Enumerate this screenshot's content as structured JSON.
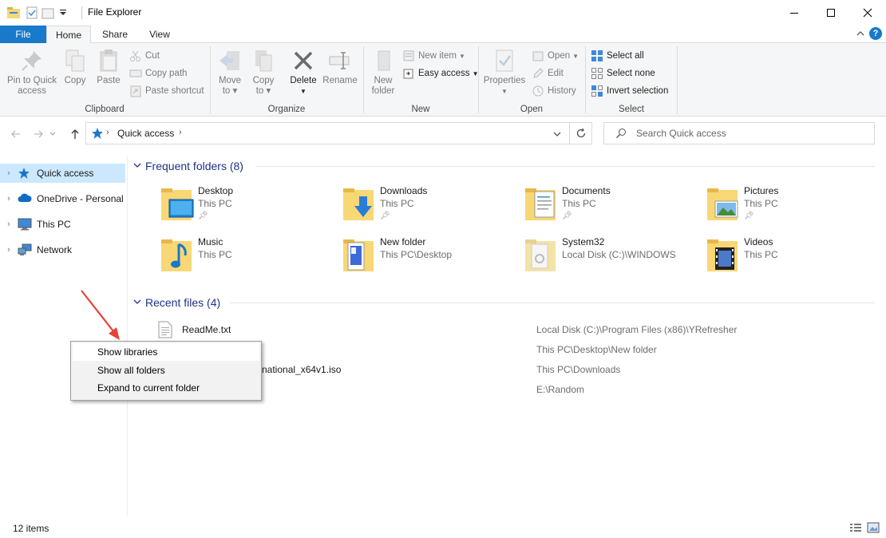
{
  "window": {
    "title": "File Explorer"
  },
  "ribbon_tabs": {
    "file": "File",
    "home": "Home",
    "share": "Share",
    "view": "View"
  },
  "ribbon": {
    "clipboard": {
      "label": "Clipboard",
      "pin_line1": "Pin to Quick",
      "pin_line2": "access",
      "copy": "Copy",
      "paste": "Paste",
      "cut": "Cut",
      "copy_path": "Copy path",
      "paste_shortcut": "Paste shortcut"
    },
    "organize": {
      "label": "Organize",
      "move_line1": "Move",
      "move_line2": "to",
      "copyto_line1": "Copy",
      "copyto_line2": "to",
      "delete": "Delete",
      "rename": "Rename"
    },
    "new": {
      "label": "New",
      "newfolder_line1": "New",
      "newfolder_line2": "folder",
      "new_item": "New item",
      "easy_access": "Easy access"
    },
    "open": {
      "label": "Open",
      "properties": "Properties",
      "open": "Open",
      "edit": "Edit",
      "history": "History"
    },
    "select": {
      "label": "Select",
      "select_all": "Select all",
      "select_none": "Select none",
      "invert_selection": "Invert selection"
    }
  },
  "address": {
    "location": "Quick access",
    "search_placeholder": "Search Quick access"
  },
  "nav": {
    "items": [
      {
        "label": "Quick access"
      },
      {
        "label": "OneDrive - Personal"
      },
      {
        "label": "This PC"
      },
      {
        "label": "Network"
      }
    ]
  },
  "frequent": {
    "header": "Frequent folders (8)",
    "folders": [
      {
        "name": "Desktop",
        "location": "This PC",
        "icon": "desktop-folder-icon"
      },
      {
        "name": "Downloads",
        "location": "This PC",
        "icon": "downloads-folder-icon"
      },
      {
        "name": "Documents",
        "location": "This PC",
        "icon": "documents-folder-icon"
      },
      {
        "name": "Pictures",
        "location": "This PC",
        "icon": "pictures-folder-icon"
      },
      {
        "name": "Music",
        "location": "This PC",
        "icon": "music-folder-icon"
      },
      {
        "name": "New folder",
        "location": "This PC\\Desktop",
        "icon": "new-folder-icon"
      },
      {
        "name": "System32",
        "location": "Local Disk (C:)\\WINDOWS",
        "icon": "system32-folder-icon"
      },
      {
        "name": "Videos",
        "location": "This PC",
        "icon": "videos-folder-icon"
      }
    ]
  },
  "recent": {
    "header": "Recent files (4)",
    "files": [
      {
        "name": "ReadMe.txt",
        "path": "Local Disk (C:)\\Program Files (x86)\\YRefresher"
      },
      {
        "name": "",
        "path": "This PC\\Desktop\\New folder"
      },
      {
        "name": "national_x64v1.iso",
        "path": "This PC\\Downloads"
      },
      {
        "name": "",
        "path": "E:\\Random"
      }
    ]
  },
  "context_menu": {
    "items": [
      {
        "label": "Show libraries"
      },
      {
        "label": "Show all folders"
      },
      {
        "label": "Expand to current folder"
      }
    ]
  },
  "status": {
    "item_count": "12 items"
  },
  "colors": {
    "accent": "#1979ca",
    "nav_selected": "#cce8ff",
    "section_header": "#1e3287",
    "folder_yellow": "#f8d775",
    "arrow_red": "#e8413c"
  }
}
